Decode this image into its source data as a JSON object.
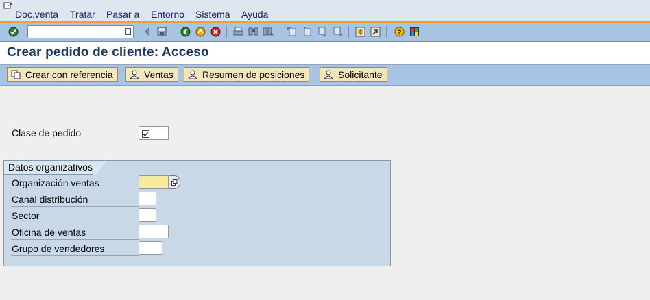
{
  "menu": {
    "items": [
      "Doc.venta",
      "Tratar",
      "Pasar a",
      "Entorno",
      "Sistema",
      "Ayuda"
    ]
  },
  "toolbar": {
    "command_field_value": "",
    "icons": [
      "enter-icon",
      "command-dropdown-icon",
      "back-arrow-icon",
      "save-icon",
      "back-icon",
      "exit-icon",
      "cancel-icon",
      "print-icon",
      "find-icon",
      "find-next-icon",
      "first-page-icon",
      "previous-page-icon",
      "next-page-icon",
      "last-page-icon",
      "new-session-icon",
      "shortcut-icon",
      "help-icon",
      "layout-icon"
    ]
  },
  "title": "Crear pedido de cliente: Acceso",
  "app_toolbar": {
    "buttons": [
      "Crear con referencia",
      "Ventas",
      "Resumen de posiciones",
      "Solicitante"
    ]
  },
  "order_type": {
    "label": "Clase de pedido",
    "value": ""
  },
  "org_data": {
    "title": "Datos organizativos",
    "fields": [
      {
        "label": "Organización ventas",
        "value": ""
      },
      {
        "label": "Canal distribución",
        "value": ""
      },
      {
        "label": "Sector",
        "value": ""
      },
      {
        "label": "Oficina de ventas",
        "value": ""
      },
      {
        "label": "Grupo de vendedores",
        "value": ""
      }
    ]
  },
  "colors": {
    "menubar_bg": "#dfe6ef",
    "toolbar_bg": "#a7c4e5",
    "accent_line": "#f0a030",
    "title_color": "#1a3a66",
    "button_bg": "#f3e6bc",
    "groupbox_bg": "#c8d8e6",
    "required_field": "#fbe9a0"
  }
}
